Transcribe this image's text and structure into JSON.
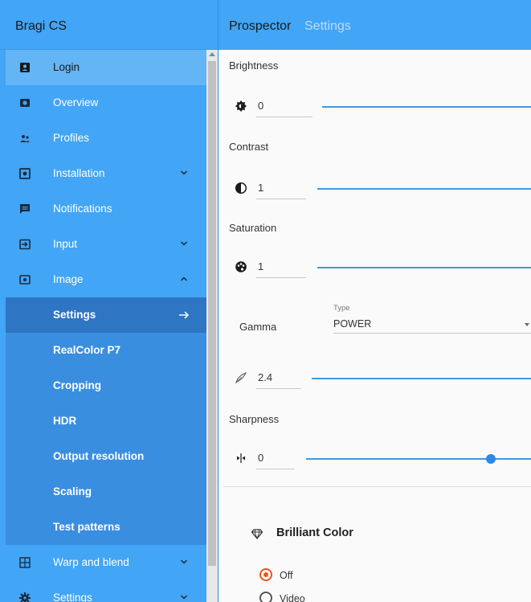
{
  "sidebar": {
    "brand": "Bragi CS",
    "items": [
      {
        "label": "Login",
        "icon": "account-box-icon"
      },
      {
        "label": "Overview",
        "icon": "camera-icon"
      },
      {
        "label": "Profiles",
        "icon": "people-icon"
      },
      {
        "label": "Installation",
        "icon": "projector-icon"
      },
      {
        "label": "Notifications",
        "icon": "message-icon"
      },
      {
        "label": "Input",
        "icon": "input-icon"
      },
      {
        "label": "Image",
        "icon": "image-icon"
      },
      {
        "label": "Warp and blend",
        "icon": "grid-icon"
      },
      {
        "label": "Settings",
        "icon": "gear-icon"
      }
    ],
    "image_sub": [
      "Settings",
      "RealColor P7",
      "Cropping",
      "HDR",
      "Output resolution",
      "Scaling",
      "Test patterns"
    ]
  },
  "header": {
    "title": "Prospector",
    "subtitle": "Settings"
  },
  "settings": {
    "brightness": {
      "label": "Brightness",
      "value": "0"
    },
    "contrast": {
      "label": "Contrast",
      "value": "1"
    },
    "saturation": {
      "label": "Saturation",
      "value": "1"
    },
    "gamma": {
      "label": "Gamma",
      "type_label": "Type",
      "type_value": "POWER",
      "value": "2.4"
    },
    "sharpness": {
      "label": "Sharpness",
      "value": "0",
      "level": 0.82
    }
  },
  "brilliant_color": {
    "title": "Brilliant Color",
    "options": [
      {
        "label": "Off",
        "checked": true
      },
      {
        "label": "Video",
        "checked": false
      }
    ]
  },
  "colors": {
    "sidebar_bg": "#42a5f5",
    "active_item": "#64b5f6",
    "submenu_bg": "#3a8ee0",
    "selected_sub": "#2e75c4",
    "accent": "#f4511e"
  }
}
